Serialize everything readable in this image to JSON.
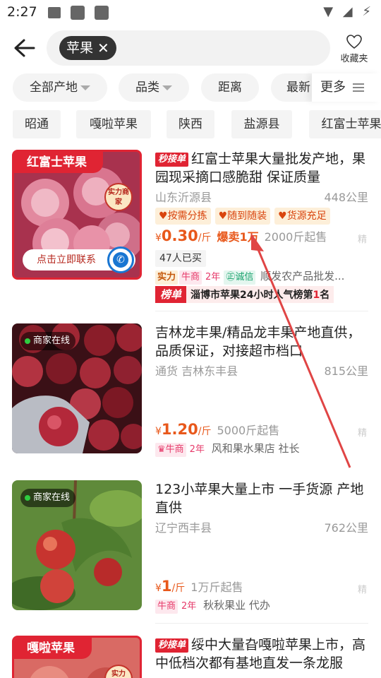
{
  "status": {
    "time": "2:27",
    "right_icons": "▼ ◢ ⚡"
  },
  "header": {
    "search_chip": "苹果",
    "favorites_label": "收藏夹"
  },
  "filters": [
    {
      "label": "全部产地",
      "dropdown": true
    },
    {
      "label": "品类",
      "dropdown": true
    },
    {
      "label": "距离",
      "dropdown": false
    },
    {
      "label": "最新",
      "dropdown": false
    }
  ],
  "more_label": "更多",
  "tags": [
    "昭通",
    "嘎啦苹果",
    "陕西",
    "盐源县",
    "红富士苹果"
  ],
  "listings": [
    {
      "banner": "红富士苹果",
      "seal": "实力商家",
      "contact": "点击立即联系",
      "order_badge": "秒接单",
      "title": "红富士苹果大量批发产地，果园现采摘口感脆甜 保证质量",
      "location": "山东沂源县",
      "distance": "448公里",
      "features": [
        "按需分拣",
        "随到随装",
        "货源充足"
      ],
      "currency": "¥",
      "price": "0.30",
      "unit": "/斤",
      "hot": "爆卖1万",
      "moq": "2000斤起售",
      "jing": "精",
      "bought": "47人已买",
      "meta_strength": "实力",
      "meta_niu": "牛商",
      "meta_years": "2年",
      "meta_cx": "诚信",
      "seller": "顺发农产品批发...",
      "rank_badge": "榜单",
      "rank_text_a": "淄博市苹果24小时人气榜第",
      "rank_num": "1",
      "rank_text_b": "名"
    },
    {
      "online": "商家在线",
      "title": "吉林龙丰果/精品龙丰果产地直供，品质保证，对接超市档口",
      "location": "通货   吉林东丰县",
      "distance": "815公里",
      "currency": "¥",
      "price": "1.20",
      "unit": "/斤",
      "moq": "5000斤起售",
      "jing": "精",
      "meta_niu": "牛商",
      "meta_years": "2年",
      "seller": "风和果水果店 社长"
    },
    {
      "online": "商家在线",
      "title": "123小苹果大量上市 一手货源 产地直供",
      "location": "辽宁西丰县",
      "distance": "762公里",
      "currency": "¥",
      "price": "1",
      "unit": "/斤",
      "moq": "1万斤起售",
      "jing": "精",
      "meta_niu": "牛商",
      "meta_years": "2年",
      "seller": "秋秋果业 代办"
    },
    {
      "banner": "嘎啦苹果",
      "seal": "实力",
      "order_badge": "秒接单",
      "title": "绥中大量旮嘎啦苹果上市，高中低档次都有基地直发一条龙服"
    }
  ]
}
